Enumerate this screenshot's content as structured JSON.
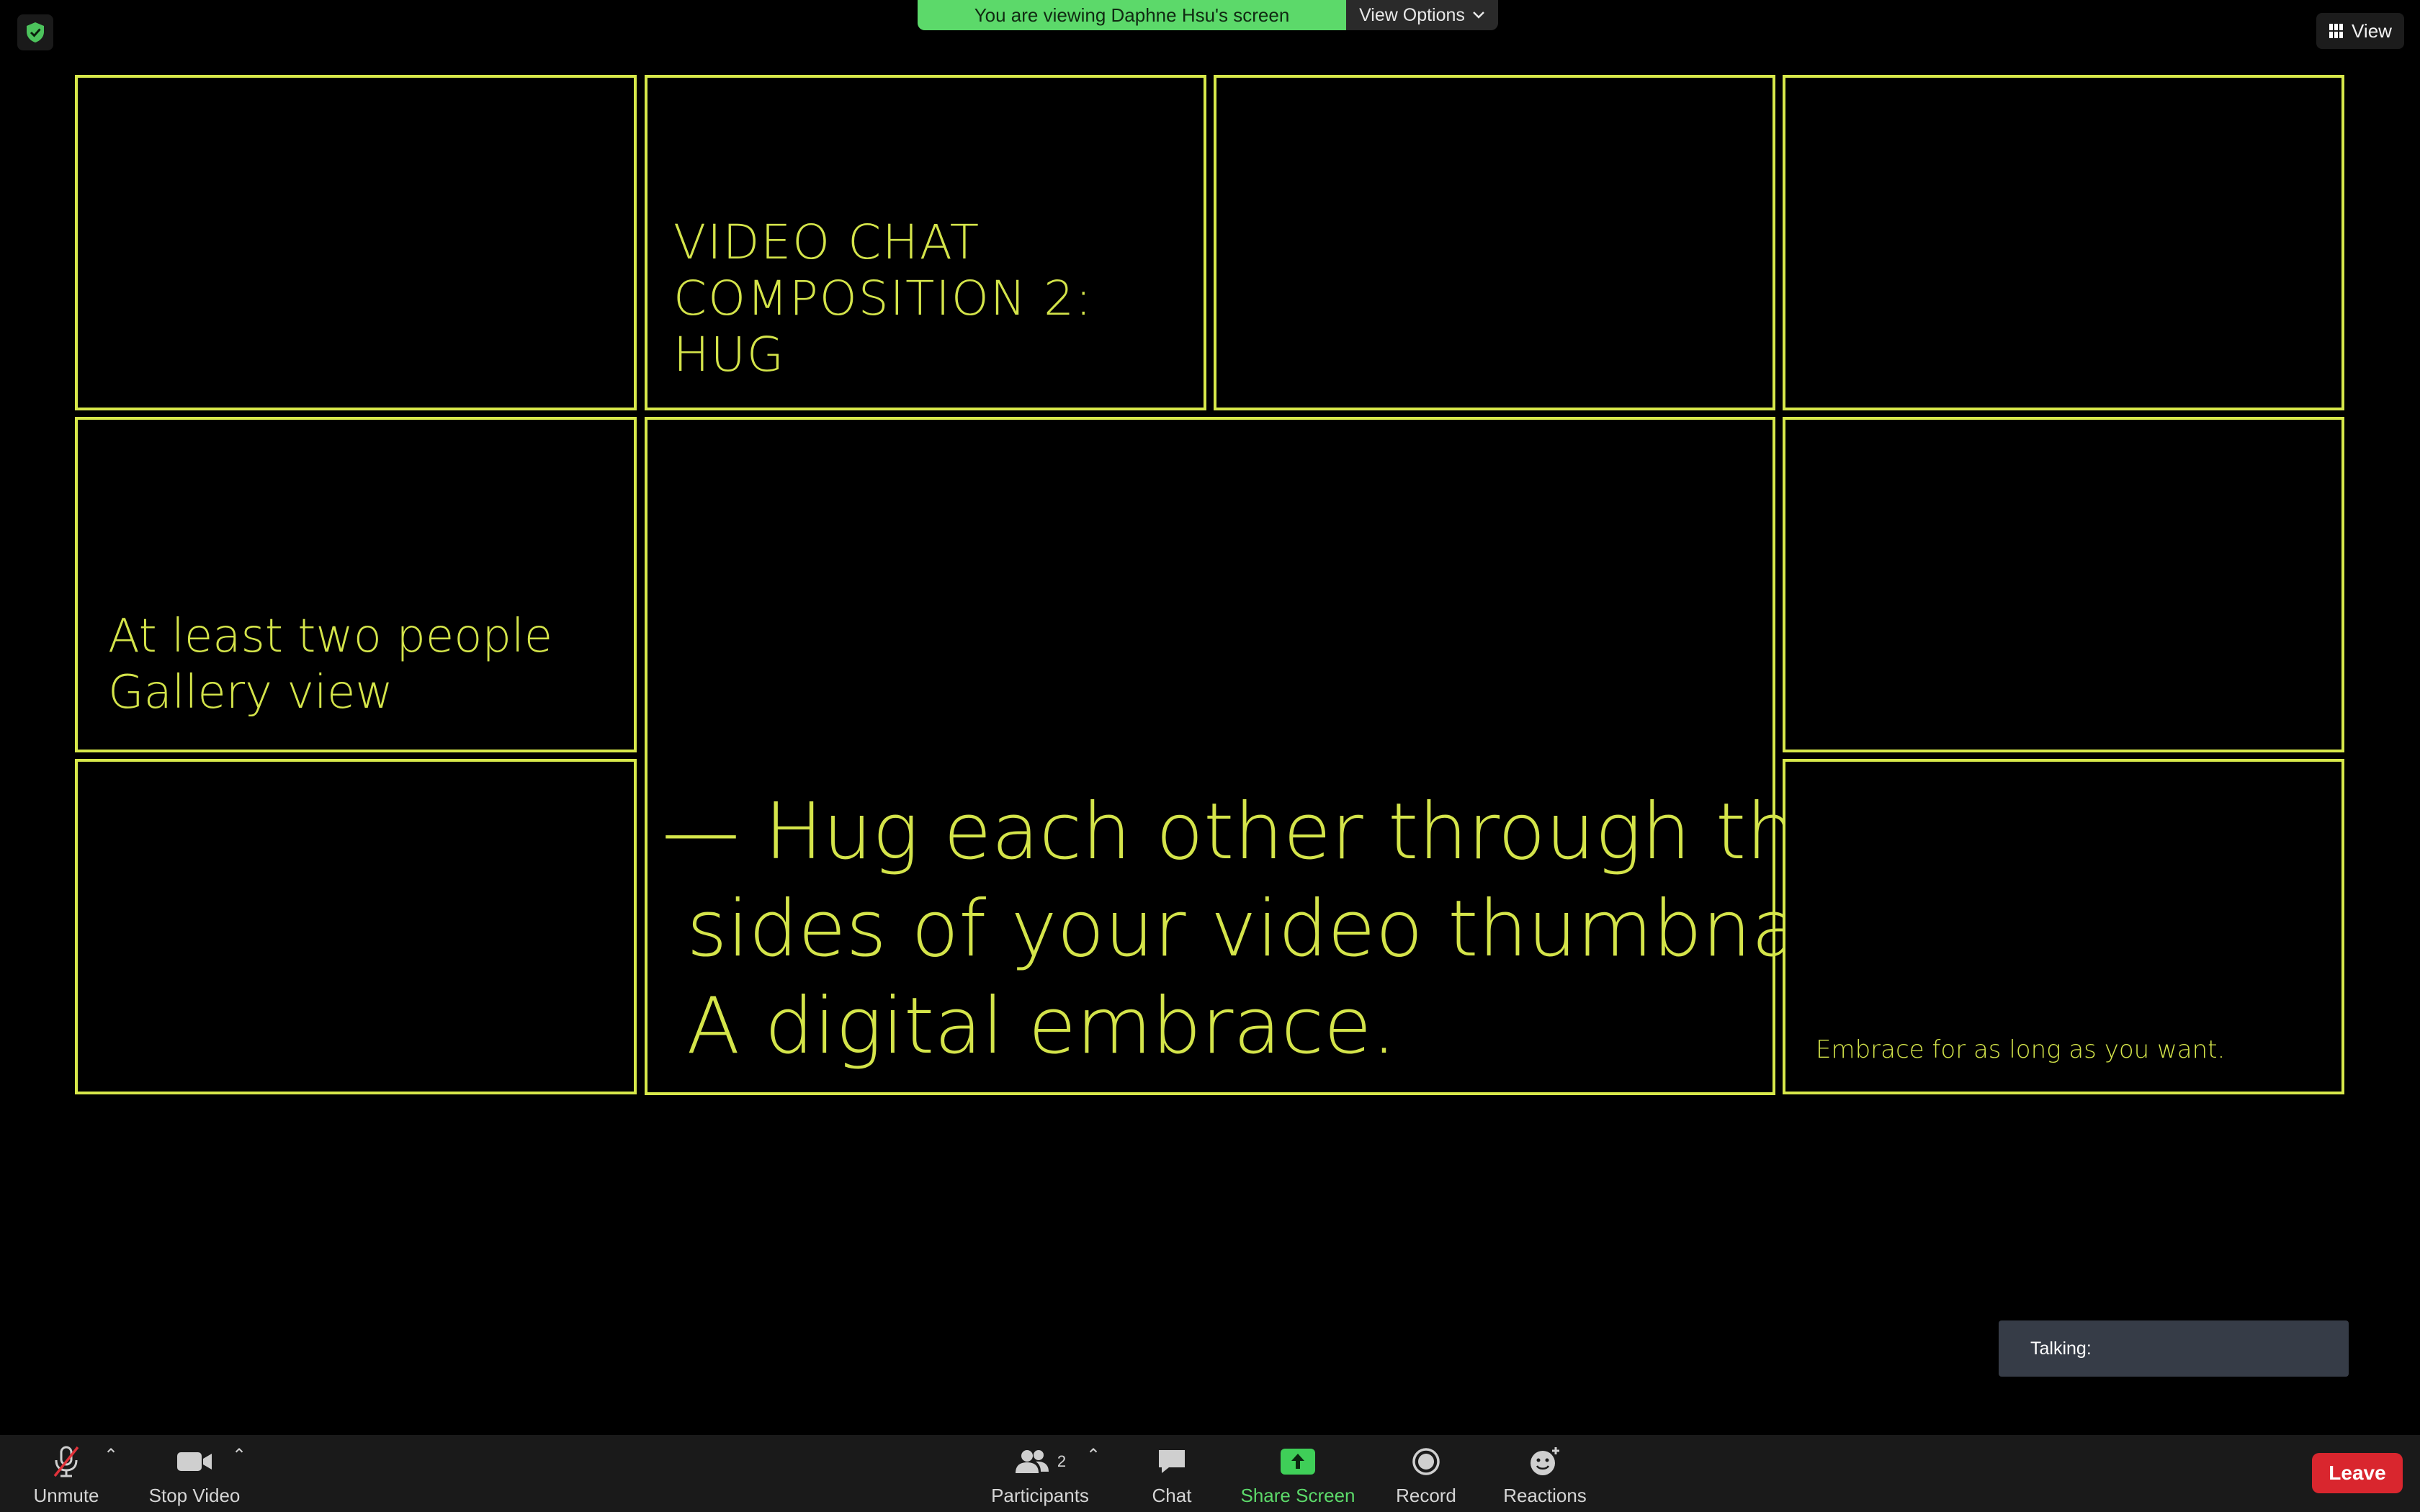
{
  "banner": {
    "viewing_text": "You are viewing Daphne Hsu's screen",
    "view_options_label": "View Options"
  },
  "view_button": {
    "label": "View"
  },
  "slide": {
    "title": "VIDEO CHAT\nCOMPOSITION 2:\nHUG",
    "subtitle": "At least two people\nGallery view",
    "main": "— Hug each other through the\n sides of your video thumbnails.\n A digital embrace.",
    "note": "Embrace for as long as you want.",
    "border_color": "#d7e84a",
    "text_color": "#d4e44a"
  },
  "talking": {
    "label": "Talking:"
  },
  "toolbar": {
    "unmute": "Unmute",
    "stop_video": "Stop Video",
    "participants": "Participants",
    "participants_count": "2",
    "chat": "Chat",
    "share_screen": "Share Screen",
    "record": "Record",
    "reactions": "Reactions",
    "leave": "Leave",
    "share_color": "#5cd96a",
    "leave_color": "#d9262e"
  },
  "icons": [
    "shield-check-icon",
    "gallery-grid-icon",
    "chevron-down-icon",
    "muted-mic-icon",
    "video-camera-icon",
    "participants-icon",
    "chat-icon",
    "share-screen-icon",
    "record-icon",
    "reactions-icon"
  ]
}
